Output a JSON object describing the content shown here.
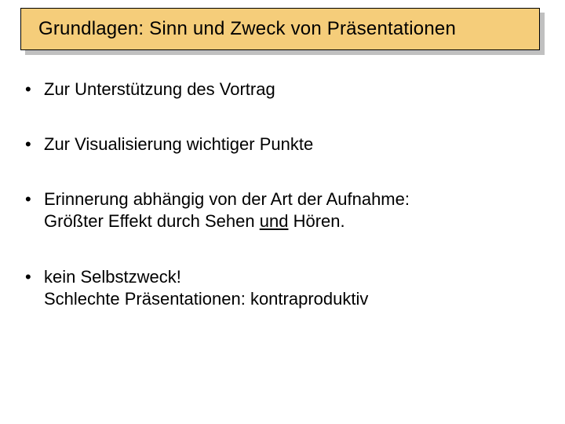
{
  "title": "Grundlagen: Sinn und Zweck von Präsentationen",
  "bullets": {
    "b1": "Zur Unterstützung des Vortrag",
    "b2": "Zur Visualisierung wichtiger Punkte",
    "b3_1": "Erinnerung abhängig von der Art der Aufnahme:",
    "b3_2a": "Größter Effekt durch Sehen ",
    "b3_2u": "und",
    "b3_2b": " Hören.",
    "b4_1": "kein Selbstzweck!",
    "b4_2": "Schlechte Präsentationen: kontraproduktiv"
  }
}
